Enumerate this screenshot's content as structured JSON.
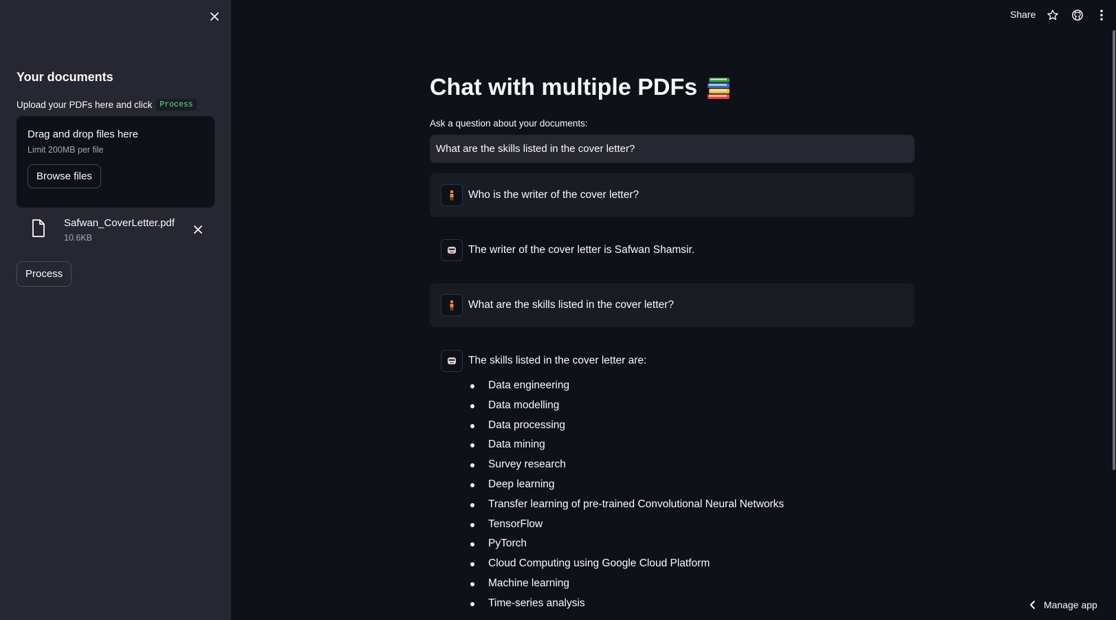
{
  "sidebar": {
    "title": "Your documents",
    "instruction": "Upload your PDFs here and click",
    "instruction_code": "Process",
    "dropzone": {
      "title": "Drag and drop files here",
      "limit": "Limit 200MB per file",
      "browse_label": "Browse files"
    },
    "file": {
      "name": "Safwan_CoverLetter.pdf",
      "size": "10.6KB"
    },
    "process_label": "Process"
  },
  "topbar": {
    "share_label": "Share"
  },
  "main": {
    "title": "Chat with multiple PDFs",
    "title_emoji": "books-emoji",
    "question_label": "Ask a question about your documents:",
    "question_value": "What are the skills listed in the cover letter?",
    "messages": [
      {
        "role": "user",
        "text": "Who is the writer of the cover letter?"
      },
      {
        "role": "bot",
        "text": "The writer of the cover letter is Safwan Shamsir."
      },
      {
        "role": "user",
        "text": "What are the skills listed in the cover letter?"
      },
      {
        "role": "bot",
        "text": "The skills listed in the cover letter are:"
      }
    ],
    "skills": [
      "Data engineering",
      "Data modelling",
      "Data processing",
      "Data mining",
      "Survey research",
      "Deep learning",
      "Transfer learning of pre-trained Convolutional Neural Networks",
      "TensorFlow",
      "PyTorch",
      "Cloud Computing using Google Cloud Platform",
      "Machine learning",
      "Time-series analysis"
    ]
  },
  "footer": {
    "manage_label": "Manage app"
  },
  "colors": {
    "background": "#0e1117",
    "sidebar": "#262730",
    "accent_code": "#5ce488"
  }
}
